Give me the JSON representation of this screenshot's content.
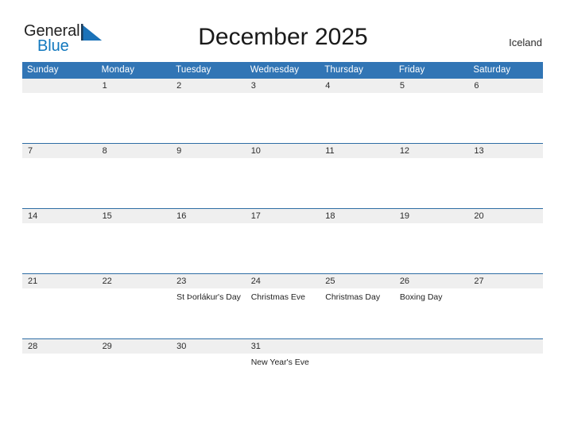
{
  "brand": {
    "word_one": "General",
    "word_two": "Blue",
    "accent_color": "#1278be"
  },
  "header": {
    "title": "December 2025",
    "region": "Iceland"
  },
  "theme": {
    "header_blue": "#3175b5",
    "rule_blue": "#2e6da4",
    "daynum_band": "#efefef"
  },
  "calendar": {
    "weekday_headers": [
      "Sunday",
      "Monday",
      "Tuesday",
      "Wednesday",
      "Thursday",
      "Friday",
      "Saturday"
    ],
    "weeks": [
      [
        {
          "day": "",
          "event": ""
        },
        {
          "day": "1",
          "event": ""
        },
        {
          "day": "2",
          "event": ""
        },
        {
          "day": "3",
          "event": ""
        },
        {
          "day": "4",
          "event": ""
        },
        {
          "day": "5",
          "event": ""
        },
        {
          "day": "6",
          "event": ""
        }
      ],
      [
        {
          "day": "7",
          "event": ""
        },
        {
          "day": "8",
          "event": ""
        },
        {
          "day": "9",
          "event": ""
        },
        {
          "day": "10",
          "event": ""
        },
        {
          "day": "11",
          "event": ""
        },
        {
          "day": "12",
          "event": ""
        },
        {
          "day": "13",
          "event": ""
        }
      ],
      [
        {
          "day": "14",
          "event": ""
        },
        {
          "day": "15",
          "event": ""
        },
        {
          "day": "16",
          "event": ""
        },
        {
          "day": "17",
          "event": ""
        },
        {
          "day": "18",
          "event": ""
        },
        {
          "day": "19",
          "event": ""
        },
        {
          "day": "20",
          "event": ""
        }
      ],
      [
        {
          "day": "21",
          "event": ""
        },
        {
          "day": "22",
          "event": ""
        },
        {
          "day": "23",
          "event": "St Þorlákur's Day"
        },
        {
          "day": "24",
          "event": "Christmas Eve"
        },
        {
          "day": "25",
          "event": "Christmas Day"
        },
        {
          "day": "26",
          "event": "Boxing Day"
        },
        {
          "day": "27",
          "event": ""
        }
      ],
      [
        {
          "day": "28",
          "event": ""
        },
        {
          "day": "29",
          "event": ""
        },
        {
          "day": "30",
          "event": ""
        },
        {
          "day": "31",
          "event": "New Year's Eve"
        },
        {
          "day": "",
          "event": ""
        },
        {
          "day": "",
          "event": ""
        },
        {
          "day": "",
          "event": ""
        }
      ]
    ]
  }
}
